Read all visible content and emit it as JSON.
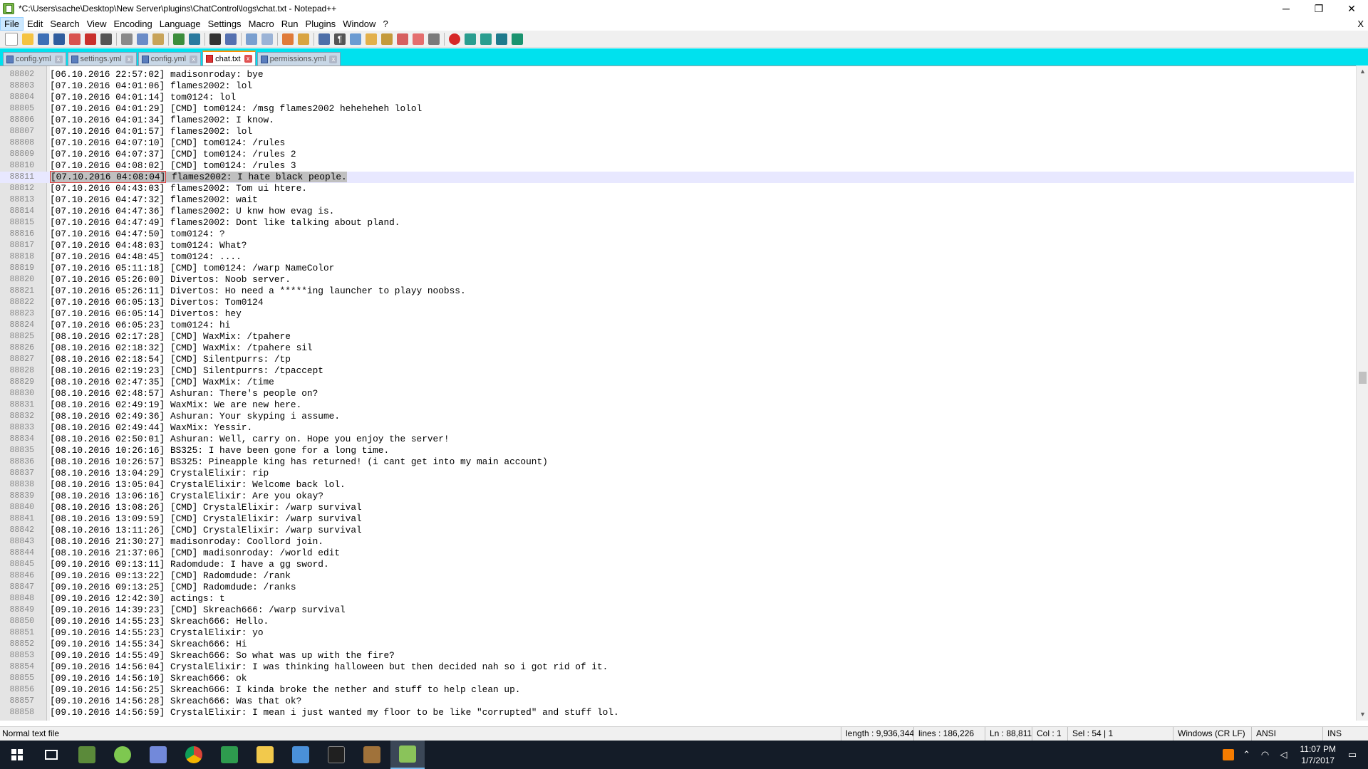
{
  "window": {
    "title": "*C:\\Users\\sache\\Desktop\\New Server\\plugins\\ChatControl\\logs\\chat.txt - Notepad++",
    "controls": [
      "─",
      "❐",
      "✕"
    ]
  },
  "menu": {
    "items": [
      "File",
      "Edit",
      "Search",
      "View",
      "Encoding",
      "Language",
      "Settings",
      "Macro",
      "Run",
      "Plugins",
      "Window",
      "?"
    ],
    "close": "X"
  },
  "tabs": [
    {
      "label": "config.yml",
      "active": false
    },
    {
      "label": "settings.yml",
      "active": false
    },
    {
      "label": "config.yml",
      "active": false
    },
    {
      "label": "chat.txt",
      "active": true
    },
    {
      "label": "permissions.yml",
      "active": false
    }
  ],
  "editor": {
    "current_line": "88811",
    "lines": [
      {
        "n": "88802",
        "t": "[06.10.2016 22:57:02] madisonroday: bye"
      },
      {
        "n": "88803",
        "t": "[07.10.2016 04:01:06] flames2002: lol"
      },
      {
        "n": "88804",
        "t": "[07.10.2016 04:01:14] tom0124: lol"
      },
      {
        "n": "88805",
        "t": "[07.10.2016 04:01:29] [CMD] tom0124: /msg flames2002 heheheheh lolol"
      },
      {
        "n": "88806",
        "t": "[07.10.2016 04:01:34] flames2002: I know."
      },
      {
        "n": "88807",
        "t": "[07.10.2016 04:01:57] flames2002: lol"
      },
      {
        "n": "88808",
        "t": "[07.10.2016 04:07:10] [CMD] tom0124: /rules"
      },
      {
        "n": "88809",
        "t": "[07.10.2016 04:07:37] [CMD] tom0124: /rules 2"
      },
      {
        "n": "88810",
        "t": "[07.10.2016 04:08:02] [CMD] tom0124: /rules 3"
      },
      {
        "n": "88811",
        "ts": "[07.10.2016 04:08:04]",
        "t": " flames2002: I hate black people."
      },
      {
        "n": "88812",
        "t": "[07.10.2016 04:43:03] flames2002: Tom ui htere."
      },
      {
        "n": "88813",
        "t": "[07.10.2016 04:47:32] flames2002: wait"
      },
      {
        "n": "88814",
        "t": "[07.10.2016 04:47:36] flames2002: U knw how evag is."
      },
      {
        "n": "88815",
        "t": "[07.10.2016 04:47:49] flames2002: Dont like talking about pland."
      },
      {
        "n": "88816",
        "t": "[07.10.2016 04:47:50] tom0124: ?"
      },
      {
        "n": "88817",
        "t": "[07.10.2016 04:48:03] tom0124: What?"
      },
      {
        "n": "88818",
        "t": "[07.10.2016 04:48:45] tom0124: ...."
      },
      {
        "n": "88819",
        "t": "[07.10.2016 05:11:18] [CMD] tom0124: /warp NameColor"
      },
      {
        "n": "88820",
        "t": "[07.10.2016 05:26:00] Divertos: Noob server."
      },
      {
        "n": "88821",
        "t": "[07.10.2016 05:26:11] Divertos: Ho need a *****ing launcher to playy noobss."
      },
      {
        "n": "88822",
        "t": "[07.10.2016 06:05:13] Divertos: Tom0124"
      },
      {
        "n": "88823",
        "t": "[07.10.2016 06:05:14] Divertos: hey"
      },
      {
        "n": "88824",
        "t": "[07.10.2016 06:05:23] tom0124: hi"
      },
      {
        "n": "88825",
        "t": "[08.10.2016 02:17:28] [CMD] WaxMix: /tpahere"
      },
      {
        "n": "88826",
        "t": "[08.10.2016 02:18:32] [CMD] WaxMix: /tpahere sil"
      },
      {
        "n": "88827",
        "t": "[08.10.2016 02:18:54] [CMD] Silentpurrs: /tp"
      },
      {
        "n": "88828",
        "t": "[08.10.2016 02:19:23] [CMD] Silentpurrs: /tpaccept"
      },
      {
        "n": "88829",
        "t": "[08.10.2016 02:47:35] [CMD] WaxMix: /time"
      },
      {
        "n": "88830",
        "t": "[08.10.2016 02:48:57] Ashuran: There's people on?"
      },
      {
        "n": "88831",
        "t": "[08.10.2016 02:49:19] WaxMix: We are new here."
      },
      {
        "n": "88832",
        "t": "[08.10.2016 02:49:36] Ashuran: Your skyping i assume."
      },
      {
        "n": "88833",
        "t": "[08.10.2016 02:49:44] WaxMix: Yessir."
      },
      {
        "n": "88834",
        "t": "[08.10.2016 02:50:01] Ashuran: Well, carry on. Hope you enjoy the server!"
      },
      {
        "n": "88835",
        "t": "[08.10.2016 10:26:16] BS325: I have been gone for a long time."
      },
      {
        "n": "88836",
        "t": "[08.10.2016 10:26:57] BS325: Pineapple king has returned! (i cant get into my main account)"
      },
      {
        "n": "88837",
        "t": "[08.10.2016 13:04:29] CrystalElixir: rip"
      },
      {
        "n": "88838",
        "t": "[08.10.2016 13:05:04] CrystalElixir: Welcome back lol."
      },
      {
        "n": "88839",
        "t": "[08.10.2016 13:06:16] CrystalElixir: Are you okay?"
      },
      {
        "n": "88840",
        "t": "[08.10.2016 13:08:26] [CMD] CrystalElixir: /warp survival"
      },
      {
        "n": "88841",
        "t": "[08.10.2016 13:09:59] [CMD] CrystalElixir: /warp survival"
      },
      {
        "n": "88842",
        "t": "[08.10.2016 13:11:26] [CMD] CrystalElixir: /warp survival"
      },
      {
        "n": "88843",
        "t": "[08.10.2016 21:30:27] madisonroday: Coollord join."
      },
      {
        "n": "88844",
        "t": "[08.10.2016 21:37:06] [CMD] madisonroday: /world edit"
      },
      {
        "n": "88845",
        "t": "[09.10.2016 09:13:11] Radomdude: I have a gg sword."
      },
      {
        "n": "88846",
        "t": "[09.10.2016 09:13:22] [CMD] Radomdude: /rank"
      },
      {
        "n": "88847",
        "t": "[09.10.2016 09:13:25] [CMD] Radomdude: /ranks"
      },
      {
        "n": "88848",
        "t": "[09.10.2016 12:42:30] actings: t"
      },
      {
        "n": "88849",
        "t": "[09.10.2016 14:39:23] [CMD] Skreach666: /warp survival"
      },
      {
        "n": "88850",
        "t": "[09.10.2016 14:55:23] Skreach666: Hello."
      },
      {
        "n": "88851",
        "t": "[09.10.2016 14:55:23] CrystalElixir: yo"
      },
      {
        "n": "88852",
        "t": "[09.10.2016 14:55:34] Skreach666: Hi"
      },
      {
        "n": "88853",
        "t": "[09.10.2016 14:55:49] Skreach666: So what was up with the fire?"
      },
      {
        "n": "88854",
        "t": "[09.10.2016 14:56:04] CrystalElixir: I was thinking halloween but then decided nah so i got rid of it."
      },
      {
        "n": "88855",
        "t": "[09.10.2016 14:56:10] Skreach666: ok"
      },
      {
        "n": "88856",
        "t": "[09.10.2016 14:56:25] Skreach666: I kinda broke the nether and stuff to help clean up."
      },
      {
        "n": "88857",
        "t": "[09.10.2016 14:56:28] Skreach666: Was that ok?"
      },
      {
        "n": "88858",
        "t": "[09.10.2016 14:56:59] CrystalElixir: I mean i just wanted my floor to be like \"corrupted\" and stuff lol."
      }
    ]
  },
  "status": {
    "file_type": "Normal text file",
    "length": "length : 9,936,344",
    "lines": "lines : 186,226",
    "ln": "Ln : 88,811",
    "col": "Col : 1",
    "sel": "Sel : 54 | 1",
    "eol": "Windows (CR LF)",
    "encoding": "ANSI",
    "mode": "INS"
  },
  "taskbar": {
    "apps": [
      {
        "name": "task-view",
        "color": "#141c28"
      },
      {
        "name": "minecraft",
        "color": "#5b8a3a"
      },
      {
        "name": "launcher",
        "color": "#7ec850"
      },
      {
        "name": "discord",
        "color": "#7289da"
      },
      {
        "name": "chrome",
        "color": "#db4437"
      },
      {
        "name": "green-app",
        "color": "#2e9b4e"
      },
      {
        "name": "file-explorer",
        "color": "#f2c94c"
      },
      {
        "name": "network-app",
        "color": "#4a90d9"
      },
      {
        "name": "terminal",
        "color": "#202020"
      },
      {
        "name": "package-app",
        "color": "#a0723a"
      },
      {
        "name": "notepad-plus-plus",
        "color": "#8ac35a"
      }
    ],
    "time": "11:07 PM",
    "date": "1/7/2017"
  },
  "colors": {
    "tab_bar": "#00e1ee",
    "active_tab_accent": "#fa9100",
    "current_line": "#e8e8ff",
    "taskbar": "#141c28"
  }
}
